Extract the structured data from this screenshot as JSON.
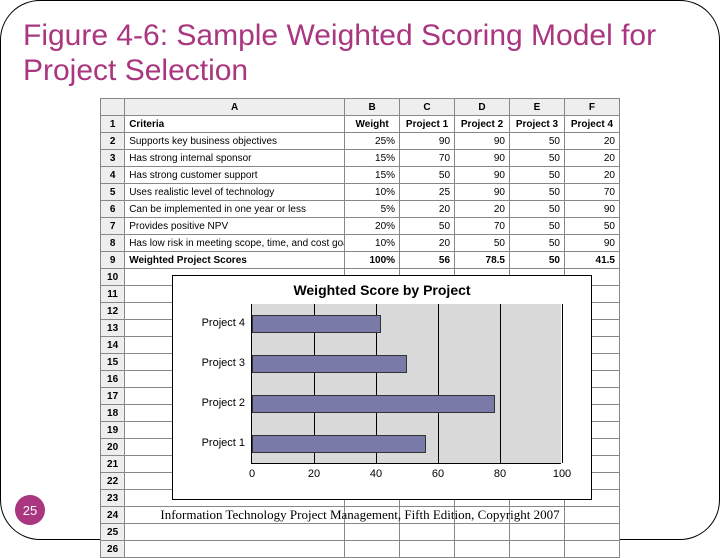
{
  "title": "Figure 4-6: Sample Weighted Scoring Model for Project Selection",
  "page_num": "25",
  "footer": "Information Technology Project Management, Fifth Edition, Copyright 2007",
  "cols": [
    "A",
    "B",
    "C",
    "D",
    "E",
    "F"
  ],
  "headers": {
    "A": "Criteria",
    "B": "Weight",
    "C": "Project 1",
    "D": "Project 2",
    "E": "Project 3",
    "F": "Project 4"
  },
  "rows": [
    {
      "A": "Supports key business objectives",
      "B": "25%",
      "C": "90",
      "D": "90",
      "E": "50",
      "F": "20"
    },
    {
      "A": "Has strong internal sponsor",
      "B": "15%",
      "C": "70",
      "D": "90",
      "E": "50",
      "F": "20"
    },
    {
      "A": "Has strong customer support",
      "B": "15%",
      "C": "50",
      "D": "90",
      "E": "50",
      "F": "20"
    },
    {
      "A": "Uses realistic level of technology",
      "B": "10%",
      "C": "25",
      "D": "90",
      "E": "50",
      "F": "70"
    },
    {
      "A": "Can be implemented in one year or less",
      "B": "5%",
      "C": "20",
      "D": "20",
      "E": "50",
      "F": "90"
    },
    {
      "A": "Provides positive NPV",
      "B": "20%",
      "C": "50",
      "D": "70",
      "E": "50",
      "F": "50"
    },
    {
      "A": "Has low risk in meeting scope, time, and cost goals",
      "B": "10%",
      "C": "20",
      "D": "50",
      "E": "50",
      "F": "90"
    }
  ],
  "totals": {
    "A": "Weighted Project Scores",
    "B": "100%",
    "C": "56",
    "D": "78.5",
    "E": "50",
    "F": "41.5"
  },
  "extra_rows": 17,
  "chart_data": {
    "type": "bar",
    "orientation": "horizontal",
    "title": "Weighted Score by Project",
    "categories": [
      "Project 4",
      "Project 3",
      "Project 2",
      "Project 1"
    ],
    "values": [
      41.5,
      50,
      78.5,
      56
    ],
    "xlim": [
      0,
      100
    ],
    "xticks": [
      0,
      20,
      40,
      60,
      80,
      100
    ]
  }
}
